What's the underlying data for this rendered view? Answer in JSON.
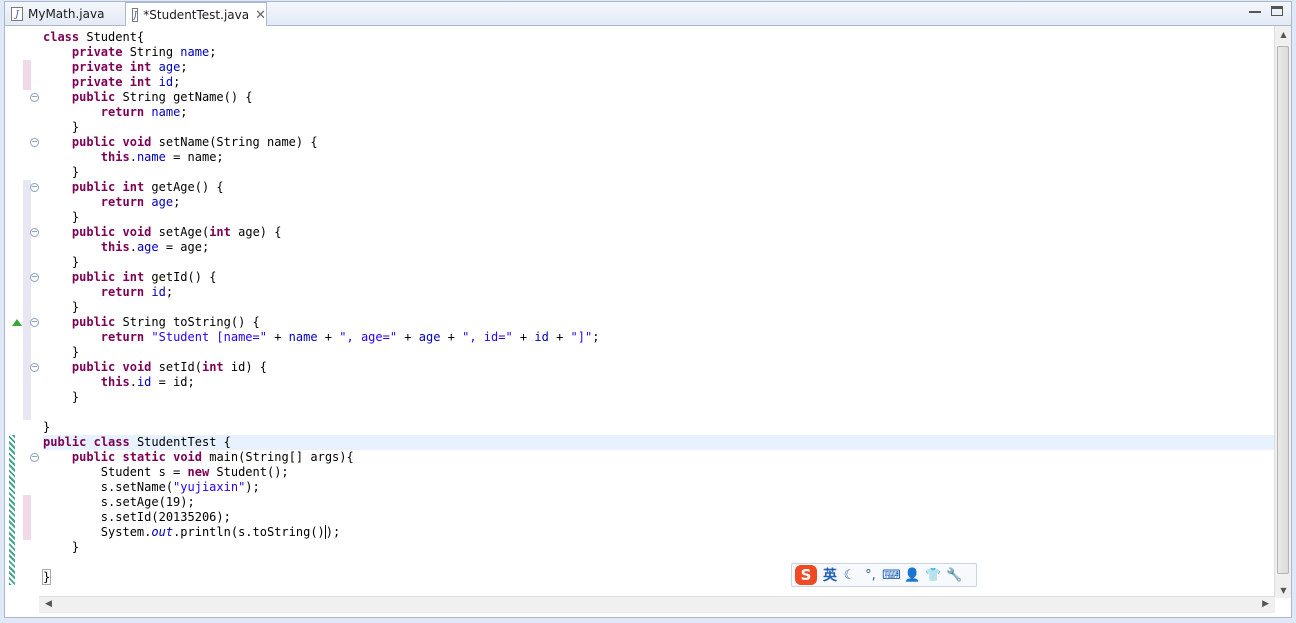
{
  "tabs": [
    {
      "label": "MyMath.java",
      "active": false
    },
    {
      "label": "*StudentTest.java",
      "active": true
    }
  ],
  "code_lines": [
    "class Student{",
    "    private String name;",
    "    private int age;",
    "    private int id;",
    "    public String getName() {",
    "        return name;",
    "    }",
    "    public void setName(String name) {",
    "        this.name = name;",
    "    }",
    "    public int getAge() {",
    "        return age;",
    "    }",
    "    public void setAge(int age) {",
    "        this.age = age;",
    "    }",
    "    public int getId() {",
    "        return id;",
    "    }",
    "    public String toString() {",
    "        return \"Student [name=\" + name + \", age=\" + age + \", id=\" + id + \"]\";",
    "    }",
    "    public void setId(int id) {",
    "        this.id = id;",
    "    }",
    "",
    "}",
    "public class StudentTest {",
    "    public static void main(String[] args){",
    "        Student s = new Student();",
    "        s.setName(\"yujiaxin\");",
    "        s.setAge(19);",
    "        s.setId(20135206);",
    "        System.out.println(s.toString());",
    "    }",
    "",
    "}"
  ],
  "current_line": 27,
  "colors": {
    "keyword": "#7f0055",
    "field": "#0000c0",
    "string": "#2a00ff",
    "current_line": "#e8f2fe"
  },
  "ime": {
    "logo": "S",
    "language": "英",
    "icons": [
      "moon-icon",
      "punctuation-icon",
      "keyboard-icon",
      "user-icon",
      "skin-shirt-icon",
      "wrench-icon"
    ]
  }
}
